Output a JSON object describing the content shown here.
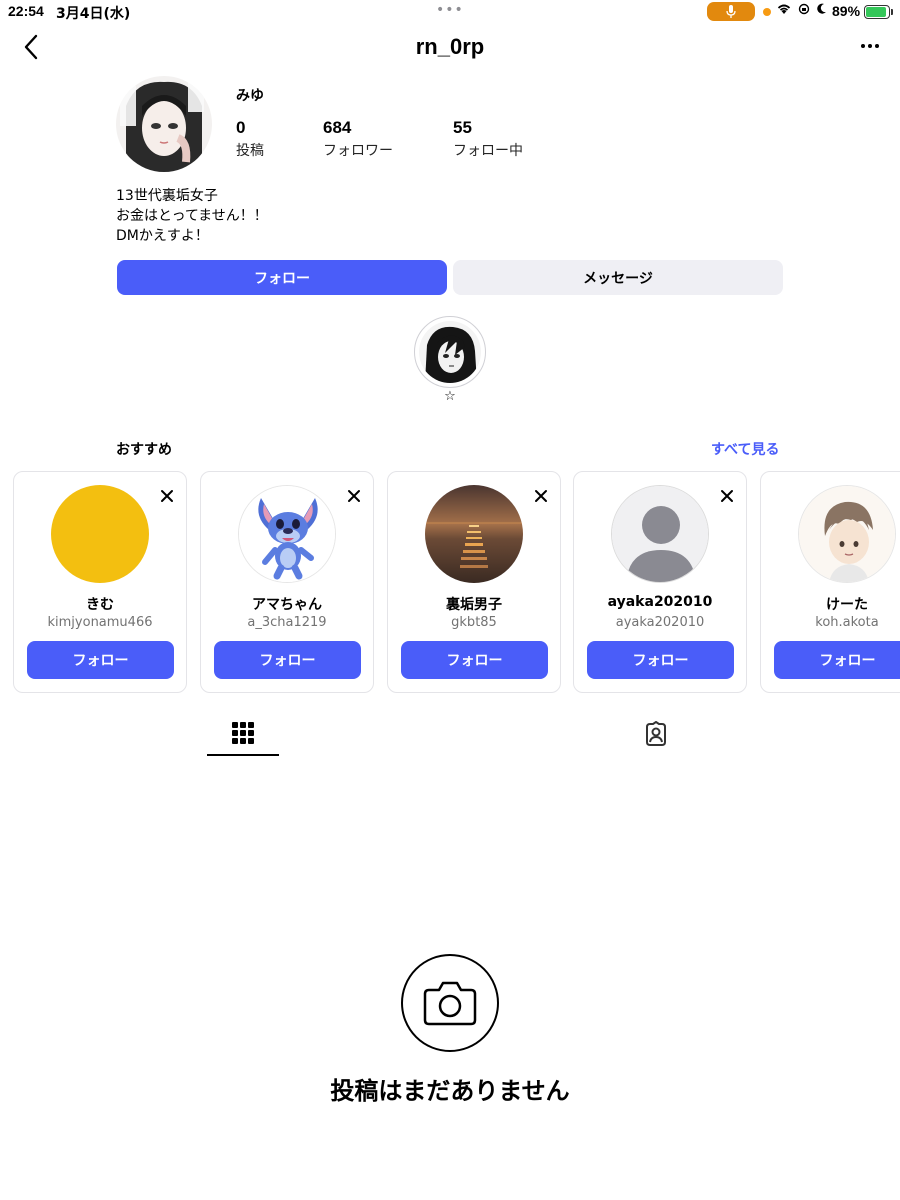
{
  "status_bar": {
    "time": "22:54",
    "date": "3月4日(水)",
    "battery_pct": "89%",
    "battery_level": 0.89,
    "mic_color": "#e2890e"
  },
  "header": {
    "username": "rn_0rp",
    "back_icon": "chevron-left-icon",
    "more_icon": "ellipsis-icon"
  },
  "profile": {
    "display_name": "みゆ",
    "stats": [
      {
        "value": "0",
        "label": "投稿"
      },
      {
        "value": "684",
        "label": "フォロワー"
      },
      {
        "value": "55",
        "label": "フォロー中"
      }
    ],
    "bio": [
      "13世代裏垢女子",
      "お金はとってません！！",
      "DMかえすよ！"
    ],
    "follow_label": "フォロー",
    "message_label": "メッセージ"
  },
  "highlight": {
    "label": "☆"
  },
  "suggestions": {
    "title": "おすすめ",
    "see_all": "すべて見る",
    "cards": [
      {
        "name": "きむ",
        "handle": "kimjyonamu466",
        "button": "フォロー"
      },
      {
        "name": "アマちゃん",
        "handle": "a_3cha1219",
        "button": "フォロー"
      },
      {
        "name": "裏垢男子",
        "handle": "gkbt85",
        "button": "フォロー"
      },
      {
        "name": "ayaka202010",
        "handle": "ayaka202010",
        "button": "フォロー"
      },
      {
        "name": "けーた",
        "handle": "koh.akota",
        "button": "フォロー"
      }
    ]
  },
  "tabs": {
    "grid_icon": "grid-icon",
    "tagged_icon": "tagged-person-icon"
  },
  "empty_state": {
    "icon": "camera-icon",
    "text": "投稿はまだありません"
  },
  "colors": {
    "accent": "#4a5df9",
    "secondary_button": "#efeff4"
  }
}
